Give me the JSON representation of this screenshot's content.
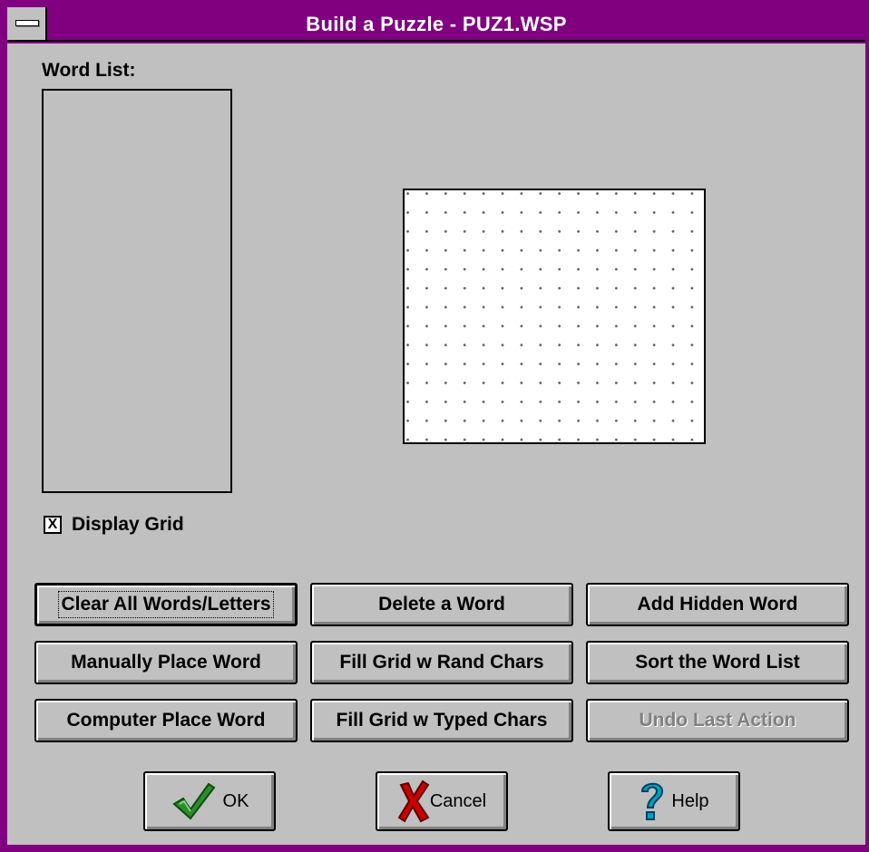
{
  "window": {
    "title": "Build a Puzzle - PUZ1.WSP"
  },
  "word_list": {
    "label": "Word List:",
    "items": []
  },
  "display_grid": {
    "label": "Display Grid",
    "checked": true,
    "mark": "X"
  },
  "buttons": {
    "clear_all": "Clear All Words/Letters",
    "delete_word": "Delete a Word",
    "add_hidden": "Add Hidden Word",
    "manual_place": "Manually Place Word",
    "fill_rand": "Fill Grid w Rand Chars",
    "sort_list": "Sort the Word List",
    "computer_place": "Computer Place Word",
    "fill_typed": "Fill Grid w Typed Chars",
    "undo": "Undo Last Action"
  },
  "dialog_buttons": {
    "ok": "OK",
    "cancel": "Cancel",
    "help": "Help"
  },
  "icons": {
    "ok": "checkmark-icon",
    "cancel": "red-x-icon",
    "help": "question-mark-icon"
  },
  "colors": {
    "title_bar": "#800080",
    "face": "#c0c0c0",
    "ok_icon": "#2e8b2e",
    "cancel_icon": "#cc0000",
    "help_icon": "#00a0c0"
  }
}
